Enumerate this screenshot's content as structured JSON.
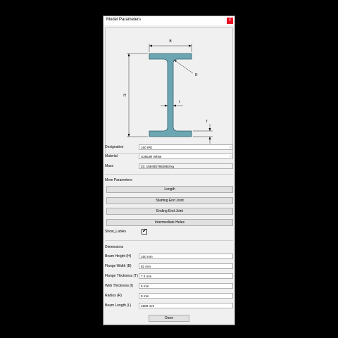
{
  "window": {
    "title": "Model Parameters",
    "close_glyph": "×"
  },
  "diagram": {
    "label_B": "B",
    "label_H": "H",
    "label_R": "R",
    "label_t": "t",
    "label_T": "T",
    "section_color": "#6ca6b3"
  },
  "designation": {
    "label": "Designation",
    "value": "160 IPE"
  },
  "material": {
    "label": "Material",
    "value": "S355JR White"
  },
  "mass": {
    "label": "Mass",
    "value": "23. 1584457862883 kg"
  },
  "more": {
    "heading": "More Parameters",
    "length_button": "Length",
    "start_joint_button": "Starting End Joint",
    "end_joint_button": "Ending End Joint",
    "holes_button": "Intermediate Holes",
    "show_labels_label": "Show_Lables",
    "show_labels_checked": true,
    "check_glyph": "✔"
  },
  "dimensions": {
    "heading": "Dimensions",
    "rows": [
      {
        "label": "Beam Height (H)",
        "value": "160 mm"
      },
      {
        "label": "Flange Width (B)",
        "value": "82 mm"
      },
      {
        "label": "Flange Thickness (T)",
        "value": "7.4 mm"
      },
      {
        "label": "Web Thickness (t)",
        "value": "5 mm"
      },
      {
        "label": "Radius (R)",
        "value": "9 mm"
      },
      {
        "label": "Beam Length (L)",
        "value": "1500 mm"
      }
    ]
  },
  "done_label": "Done"
}
